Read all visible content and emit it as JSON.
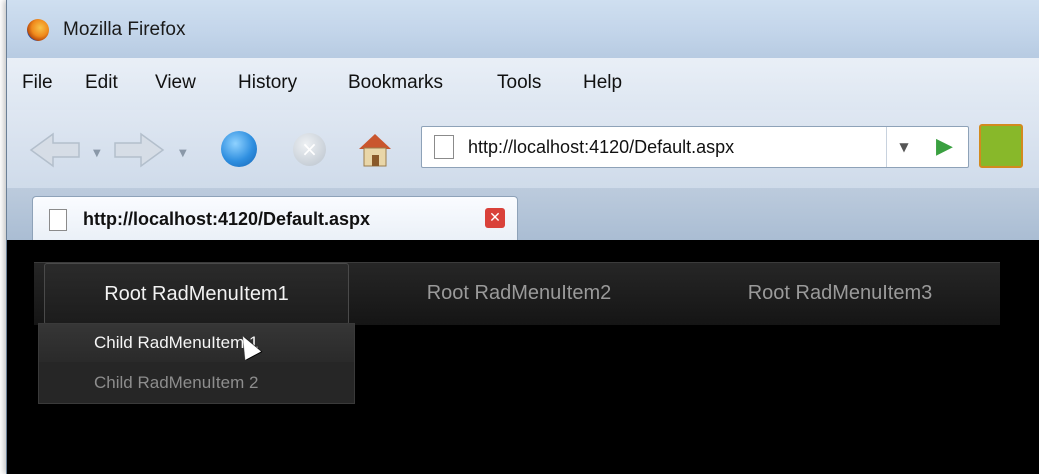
{
  "window": {
    "title": "Mozilla Firefox"
  },
  "menubar": {
    "items": [
      "File",
      "Edit",
      "View",
      "History",
      "Bookmarks",
      "Tools",
      "Help"
    ]
  },
  "toolbar": {
    "url": "http://localhost:4120/Default.aspx",
    "icons": [
      "back-icon",
      "forward-icon",
      "reload-icon",
      "stop-icon",
      "home-icon",
      "go-icon",
      "addon-icon"
    ]
  },
  "tabs": [
    {
      "title": "http://localhost:4120/Default.aspx"
    }
  ],
  "radmenu": {
    "root_items": [
      "Root RadMenuItem1",
      "Root RadMenuItem2",
      "Root RadMenuItem3"
    ],
    "child_items": [
      "Child RadMenuItem 1",
      "Child RadMenuItem 2"
    ],
    "selected_root": "Root RadMenuItem1",
    "hovered_child": "Child RadMenuItem 1"
  },
  "colors": {
    "page_background": "#000000",
    "titlebar": "#c3d5ea",
    "menu_text_active": "#f2f2f2",
    "menu_text_inactive": "#9a9a9a"
  }
}
